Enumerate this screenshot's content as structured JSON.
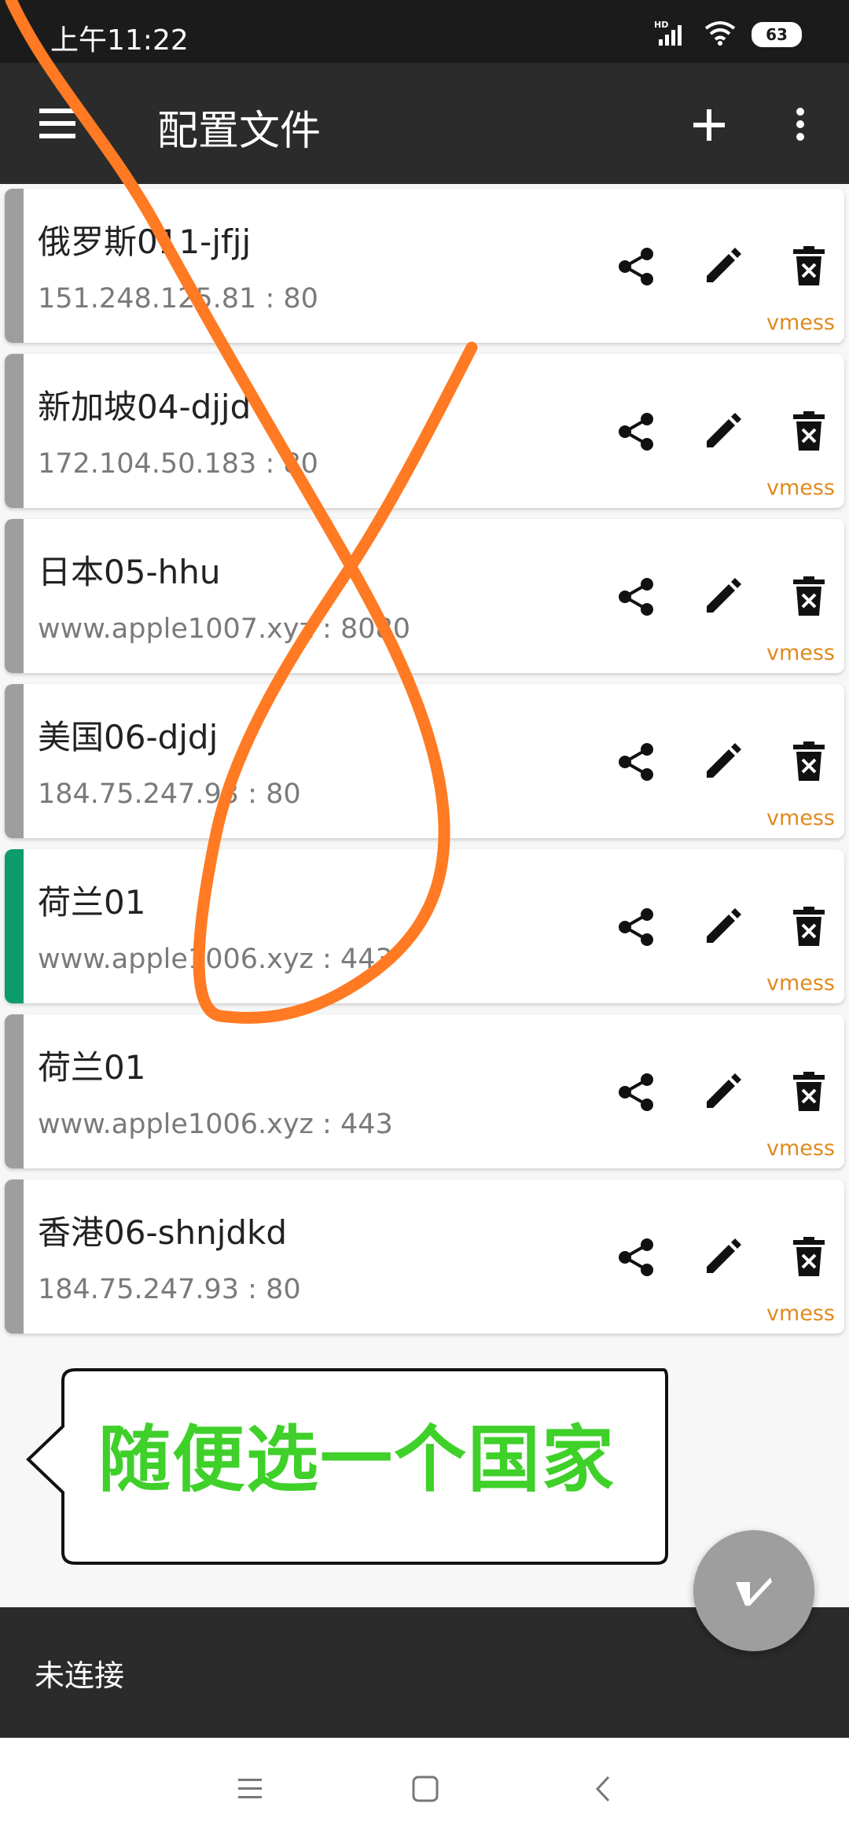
{
  "status_bar": {
    "time": "上午11:22",
    "battery": "63"
  },
  "toolbar": {
    "title": "配置文件"
  },
  "profiles": [
    {
      "name": "俄罗斯011-jfjj",
      "address": "151.248.125.81 : 80",
      "type": "vmess",
      "active": false
    },
    {
      "name": "新加坡04-djjd",
      "address": "172.104.50.183 : 80",
      "type": "vmess",
      "active": false
    },
    {
      "name": "日本05-hhu",
      "address": "www.apple1007.xyz : 8080",
      "type": "vmess",
      "active": false
    },
    {
      "name": "美国06-djdj",
      "address": "184.75.247.93 : 80",
      "type": "vmess",
      "active": false
    },
    {
      "name": "荷兰01",
      "address": "www.apple1006.xyz : 443",
      "type": "vmess",
      "active": true
    },
    {
      "name": "荷兰01",
      "address": "www.apple1006.xyz : 443",
      "type": "vmess",
      "active": false
    },
    {
      "name": "香港06-shnjdkd",
      "address": "184.75.247.93 : 80",
      "type": "vmess",
      "active": false
    }
  ],
  "callout": {
    "text": "随便选一个国家"
  },
  "bottom_bar": {
    "status": "未连接"
  },
  "colors": {
    "accent_active": "#0b9b6d",
    "stripe_inactive": "#9e9e9e",
    "protocol_label": "#e08a1e",
    "annotation_stroke": "#ff7a22",
    "callout_text": "#3fd02a"
  },
  "icons": {
    "profile_actions": [
      "share-icon",
      "edit-icon",
      "delete-icon"
    ],
    "toolbar": [
      "menu-icon",
      "add-icon",
      "more-vert-icon"
    ],
    "fab": "v-logo-icon",
    "nav": [
      "recents-icon",
      "home-icon",
      "back-icon"
    ]
  }
}
